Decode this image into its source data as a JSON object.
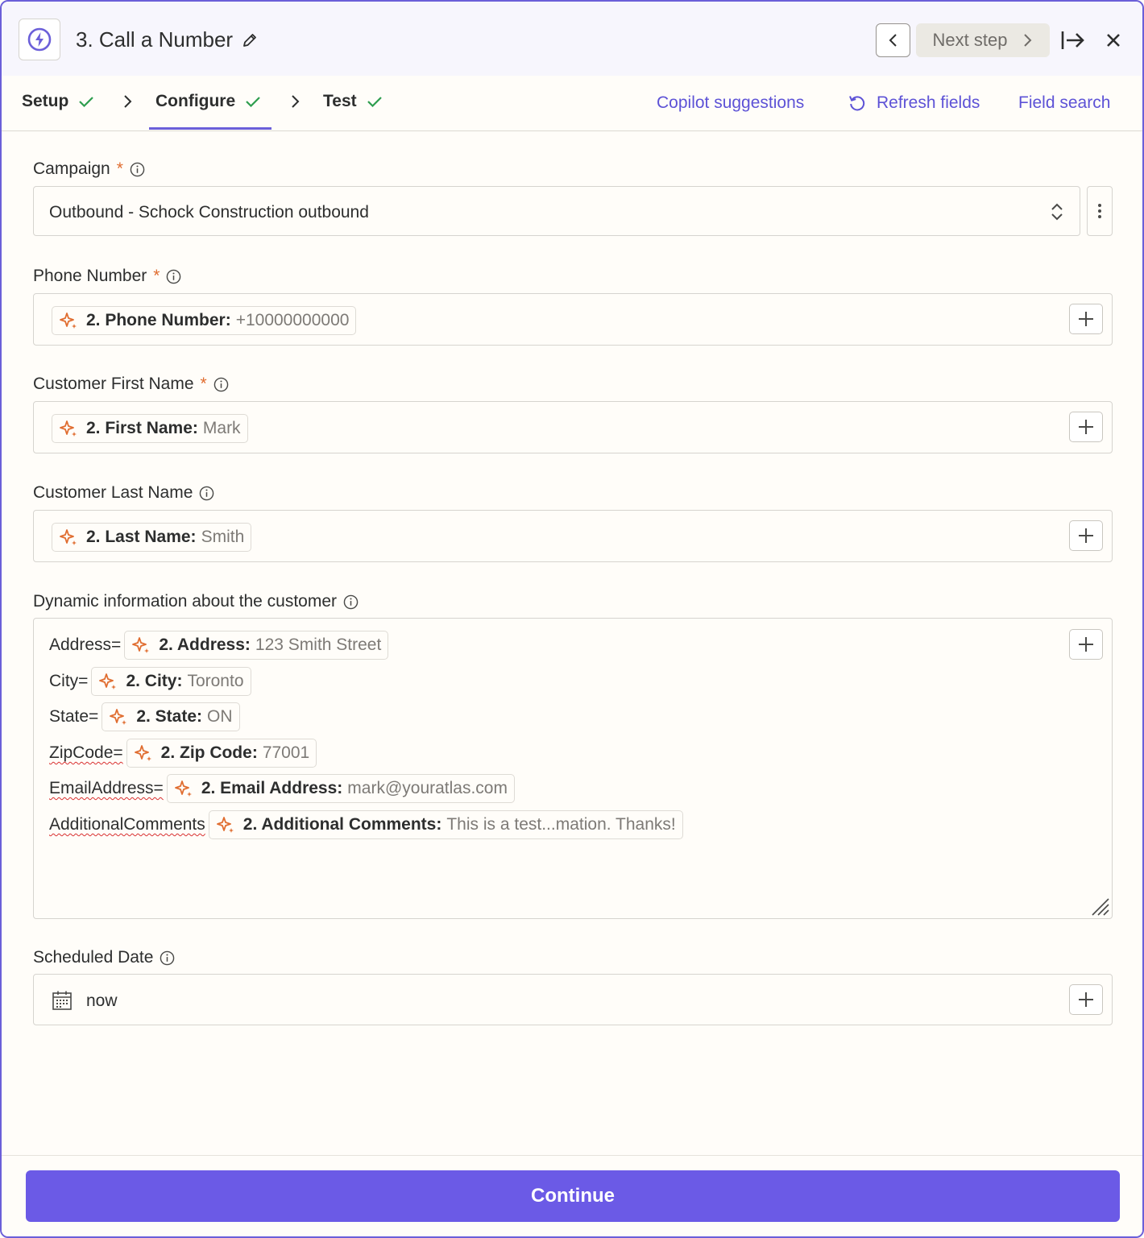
{
  "header": {
    "step_title": "3. Call a Number",
    "next_step_label": "Next step"
  },
  "tabs": [
    {
      "label": "Setup",
      "done": true
    },
    {
      "label": "Configure",
      "done": true,
      "active": true
    },
    {
      "label": "Test",
      "done": true
    }
  ],
  "actions": {
    "copilot": "Copilot suggestions",
    "refresh": "Refresh fields",
    "field_search": "Field search"
  },
  "fields": {
    "campaign": {
      "label": "Campaign",
      "required": true,
      "value": "Outbound - Schock Construction outbound"
    },
    "phone": {
      "label": "Phone Number",
      "required": true,
      "pill_key": "2. Phone Number:",
      "pill_value": "+10000000000"
    },
    "first_name": {
      "label": "Customer First Name",
      "required": true,
      "pill_key": "2. First Name:",
      "pill_value": "Mark"
    },
    "last_name": {
      "label": "Customer Last Name",
      "required": false,
      "pill_key": "2. Last Name:",
      "pill_value": "Smith"
    },
    "dynamic": {
      "label": "Dynamic information about the customer",
      "rows": [
        {
          "prefix": "Address=",
          "key": "2. Address:",
          "value": "123 Smith Street"
        },
        {
          "prefix": "City=",
          "key": "2. City:",
          "value": "Toronto"
        },
        {
          "prefix": "State=",
          "key": "2. State:",
          "value": "ON"
        },
        {
          "prefix": "ZipCode=",
          "key": "2. Zip Code:",
          "value": "77001"
        },
        {
          "prefix": "EmailAddress=",
          "key": "2. Email Address:",
          "value": "mark@youratlas.com"
        },
        {
          "prefix": "AdditionalComments",
          "key": "2. Additional Comments:",
          "value": "This is a test...mation. Thanks!"
        }
      ]
    },
    "scheduled_date": {
      "label": "Scheduled Date",
      "value": "now"
    }
  },
  "footer": {
    "continue_label": "Continue"
  },
  "colors": {
    "accent": "#6b5ae6",
    "link": "#5d52d6",
    "required": "#e06d30",
    "check": "#2e9e4f"
  }
}
